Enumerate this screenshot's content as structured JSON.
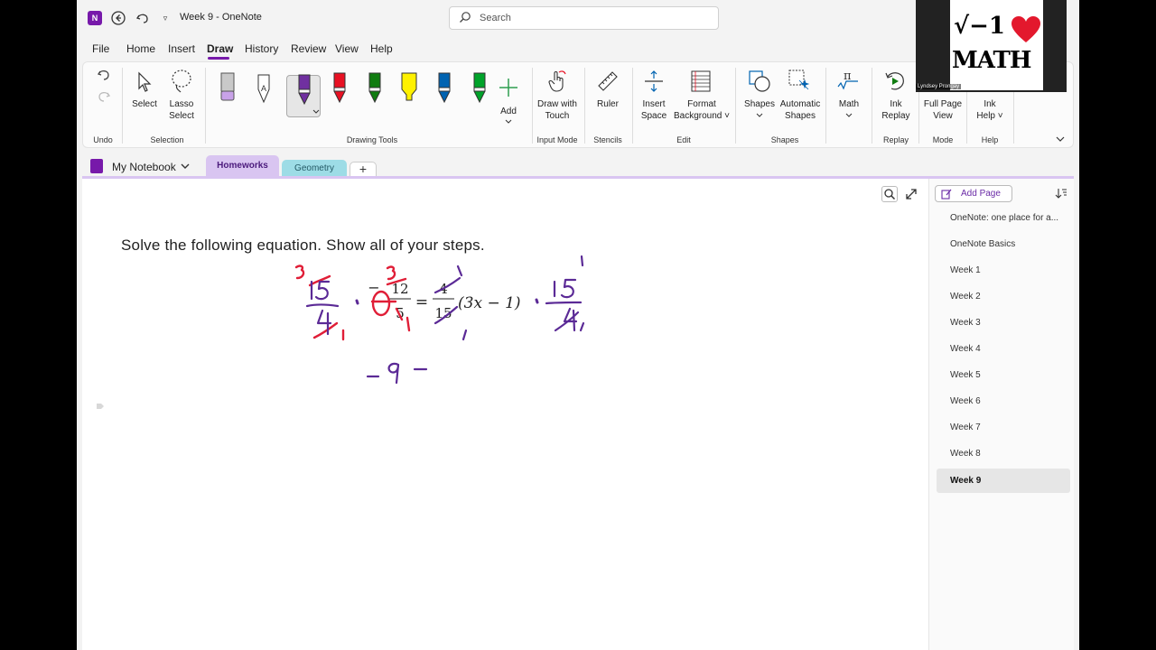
{
  "window": {
    "title": "Week 9  -  OneNote",
    "search_placeholder": "Search"
  },
  "menu": [
    "File",
    "Home",
    "Insert",
    "Draw",
    "History",
    "Review",
    "View",
    "Help"
  ],
  "ribbon": {
    "select": "Select",
    "lasso_1": "Lasso",
    "lasso_2": "Select",
    "add": "Add",
    "draw_touch_1": "Draw with",
    "draw_touch_2": "Touch",
    "ruler": "Ruler",
    "insert_space_1": "Insert",
    "insert_space_2": "Space",
    "format_bg_1": "Format",
    "format_bg_2": "Background ˅",
    "shapes": "Shapes",
    "auto_shapes_1": "Automatic",
    "auto_shapes_2": "Shapes",
    "math": "Math",
    "ink_replay_1": "Ink",
    "ink_replay_2": "Replay",
    "full_page_1": "Full Page",
    "full_page_2": "View",
    "ink_help_1": "Ink",
    "ink_help_2": "Help ˅",
    "groups": {
      "undo": "Undo",
      "selection": "Selection",
      "drawing_tools": "Drawing Tools",
      "input_mode": "Input Mode",
      "stencils": "Stencils",
      "edit": "Edit",
      "shapes": "Shapes",
      "replay": "Replay",
      "mode": "Mode",
      "help": "Help"
    },
    "pen_colors": [
      "#c8a2e8",
      "#ffffff",
      "#7030a0",
      "#e81123",
      "#107c10",
      "#fff100",
      "#0063b1",
      "#00a32a"
    ]
  },
  "notebook": {
    "name": "My Notebook",
    "sections": [
      "Homeworks",
      "Geometry"
    ],
    "add_section": "+"
  },
  "page": {
    "question": "Solve the following equation.  Show all of your steps.",
    "eq_num1": "12",
    "eq_den1": "5",
    "eq_num2": "4",
    "eq_den2": "15",
    "eq_equals": "=",
    "eq_paren": "(3x − 1)",
    "ink_colors": {
      "red": "#e01e37",
      "purple": "#5b2a96"
    }
  },
  "pages_pane": {
    "add_page": "Add Page",
    "pages": [
      "OneNote: one place for a...",
      "OneNote Basics",
      "Week 1",
      "Week 2",
      "Week 3",
      "Week 4",
      "Week 5",
      "Week 6",
      "Week 7",
      "Week 8",
      "Week 9"
    ],
    "selected": "Week 9"
  },
  "webcam": {
    "logo_line1": "√−1",
    "logo_line2": "MATH",
    "name": "Lyndsey Prongay"
  }
}
